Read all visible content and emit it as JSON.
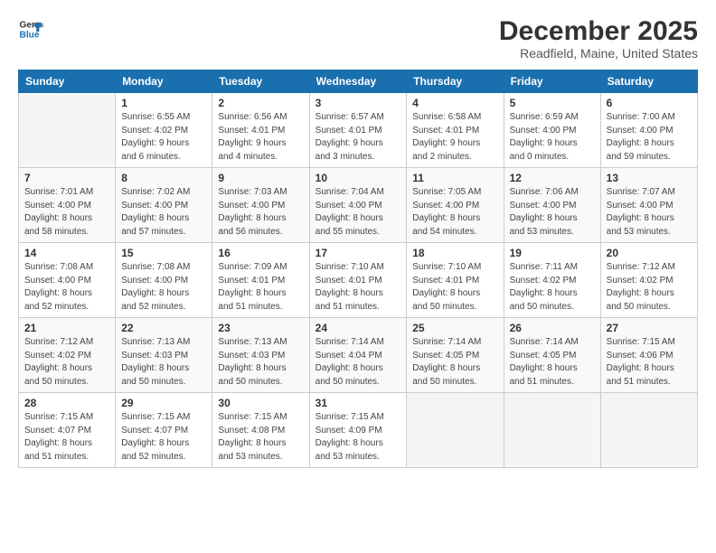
{
  "logo": {
    "line1": "General",
    "line2": "Blue"
  },
  "title": "December 2025",
  "subtitle": "Readfield, Maine, United States",
  "days_of_week": [
    "Sunday",
    "Monday",
    "Tuesday",
    "Wednesday",
    "Thursday",
    "Friday",
    "Saturday"
  ],
  "weeks": [
    [
      {
        "day": "",
        "info": ""
      },
      {
        "day": "1",
        "info": "Sunrise: 6:55 AM\nSunset: 4:02 PM\nDaylight: 9 hours\nand 6 minutes."
      },
      {
        "day": "2",
        "info": "Sunrise: 6:56 AM\nSunset: 4:01 PM\nDaylight: 9 hours\nand 4 minutes."
      },
      {
        "day": "3",
        "info": "Sunrise: 6:57 AM\nSunset: 4:01 PM\nDaylight: 9 hours\nand 3 minutes."
      },
      {
        "day": "4",
        "info": "Sunrise: 6:58 AM\nSunset: 4:01 PM\nDaylight: 9 hours\nand 2 minutes."
      },
      {
        "day": "5",
        "info": "Sunrise: 6:59 AM\nSunset: 4:00 PM\nDaylight: 9 hours\nand 0 minutes."
      },
      {
        "day": "6",
        "info": "Sunrise: 7:00 AM\nSunset: 4:00 PM\nDaylight: 8 hours\nand 59 minutes."
      }
    ],
    [
      {
        "day": "7",
        "info": "Sunrise: 7:01 AM\nSunset: 4:00 PM\nDaylight: 8 hours\nand 58 minutes."
      },
      {
        "day": "8",
        "info": "Sunrise: 7:02 AM\nSunset: 4:00 PM\nDaylight: 8 hours\nand 57 minutes."
      },
      {
        "day": "9",
        "info": "Sunrise: 7:03 AM\nSunset: 4:00 PM\nDaylight: 8 hours\nand 56 minutes."
      },
      {
        "day": "10",
        "info": "Sunrise: 7:04 AM\nSunset: 4:00 PM\nDaylight: 8 hours\nand 55 minutes."
      },
      {
        "day": "11",
        "info": "Sunrise: 7:05 AM\nSunset: 4:00 PM\nDaylight: 8 hours\nand 54 minutes."
      },
      {
        "day": "12",
        "info": "Sunrise: 7:06 AM\nSunset: 4:00 PM\nDaylight: 8 hours\nand 53 minutes."
      },
      {
        "day": "13",
        "info": "Sunrise: 7:07 AM\nSunset: 4:00 PM\nDaylight: 8 hours\nand 53 minutes."
      }
    ],
    [
      {
        "day": "14",
        "info": "Sunrise: 7:08 AM\nSunset: 4:00 PM\nDaylight: 8 hours\nand 52 minutes."
      },
      {
        "day": "15",
        "info": "Sunrise: 7:08 AM\nSunset: 4:00 PM\nDaylight: 8 hours\nand 52 minutes."
      },
      {
        "day": "16",
        "info": "Sunrise: 7:09 AM\nSunset: 4:01 PM\nDaylight: 8 hours\nand 51 minutes."
      },
      {
        "day": "17",
        "info": "Sunrise: 7:10 AM\nSunset: 4:01 PM\nDaylight: 8 hours\nand 51 minutes."
      },
      {
        "day": "18",
        "info": "Sunrise: 7:10 AM\nSunset: 4:01 PM\nDaylight: 8 hours\nand 50 minutes."
      },
      {
        "day": "19",
        "info": "Sunrise: 7:11 AM\nSunset: 4:02 PM\nDaylight: 8 hours\nand 50 minutes."
      },
      {
        "day": "20",
        "info": "Sunrise: 7:12 AM\nSunset: 4:02 PM\nDaylight: 8 hours\nand 50 minutes."
      }
    ],
    [
      {
        "day": "21",
        "info": "Sunrise: 7:12 AM\nSunset: 4:02 PM\nDaylight: 8 hours\nand 50 minutes."
      },
      {
        "day": "22",
        "info": "Sunrise: 7:13 AM\nSunset: 4:03 PM\nDaylight: 8 hours\nand 50 minutes."
      },
      {
        "day": "23",
        "info": "Sunrise: 7:13 AM\nSunset: 4:03 PM\nDaylight: 8 hours\nand 50 minutes."
      },
      {
        "day": "24",
        "info": "Sunrise: 7:14 AM\nSunset: 4:04 PM\nDaylight: 8 hours\nand 50 minutes."
      },
      {
        "day": "25",
        "info": "Sunrise: 7:14 AM\nSunset: 4:05 PM\nDaylight: 8 hours\nand 50 minutes."
      },
      {
        "day": "26",
        "info": "Sunrise: 7:14 AM\nSunset: 4:05 PM\nDaylight: 8 hours\nand 51 minutes."
      },
      {
        "day": "27",
        "info": "Sunrise: 7:15 AM\nSunset: 4:06 PM\nDaylight: 8 hours\nand 51 minutes."
      }
    ],
    [
      {
        "day": "28",
        "info": "Sunrise: 7:15 AM\nSunset: 4:07 PM\nDaylight: 8 hours\nand 51 minutes."
      },
      {
        "day": "29",
        "info": "Sunrise: 7:15 AM\nSunset: 4:07 PM\nDaylight: 8 hours\nand 52 minutes."
      },
      {
        "day": "30",
        "info": "Sunrise: 7:15 AM\nSunset: 4:08 PM\nDaylight: 8 hours\nand 53 minutes."
      },
      {
        "day": "31",
        "info": "Sunrise: 7:15 AM\nSunset: 4:09 PM\nDaylight: 8 hours\nand 53 minutes."
      },
      {
        "day": "",
        "info": ""
      },
      {
        "day": "",
        "info": ""
      },
      {
        "day": "",
        "info": ""
      }
    ]
  ]
}
